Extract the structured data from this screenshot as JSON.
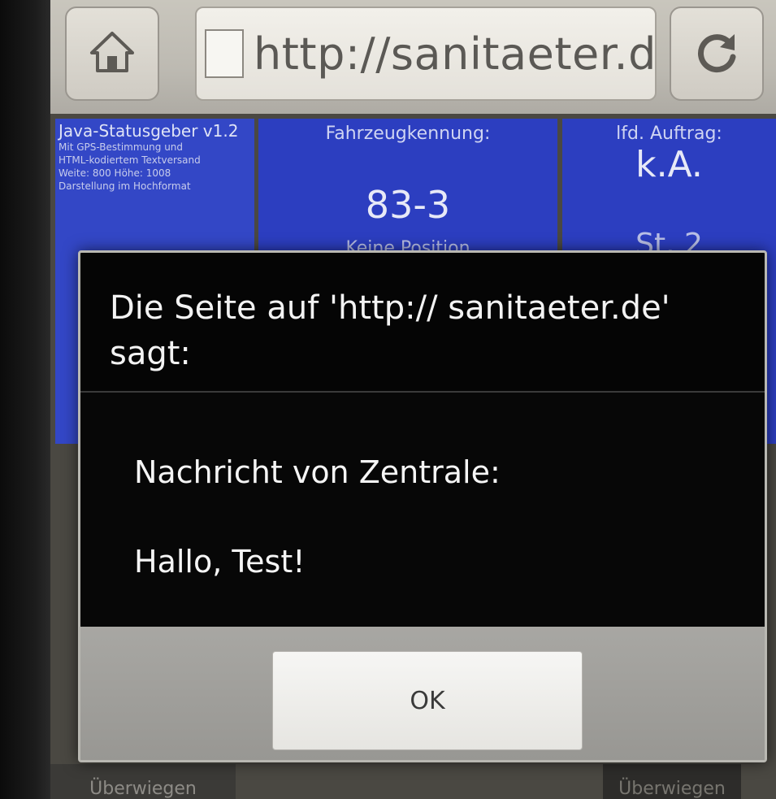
{
  "browser": {
    "url_text": "http://sanitaeter.d...",
    "home_icon": "home-icon",
    "reload_icon": "reload-icon"
  },
  "panels": {
    "info": {
      "title": "Java-Statusgeber v1.2",
      "subtitle_lines": [
        "Mit GPS-Bestimmung und",
        "HTML-kodiertem Textversand",
        "Weite: 800 Höhe: 1008",
        "Darstellung im Hochformat"
      ]
    },
    "vehicle": {
      "header": "Fahrzeugkennung:",
      "id": "83-3",
      "position": "Keine Position"
    },
    "job": {
      "header": "lfd. Auftrag:",
      "value": "k.A.",
      "status": "St. 2"
    }
  },
  "dialog": {
    "title": "Die Seite auf 'http:// sanitaeter.de' sagt:",
    "message_line1": "Nachricht von Zentrale:",
    "message_line2": "Hallo, Test!",
    "ok_label": "OK"
  },
  "bottom": {
    "left_label": "Überwiegen",
    "right_label": "Überwiegen"
  },
  "colors": {
    "panel_blue": "#2c3ec0",
    "dialog_black": "#050505",
    "toolbar_gray": "#c9c6bd"
  }
}
